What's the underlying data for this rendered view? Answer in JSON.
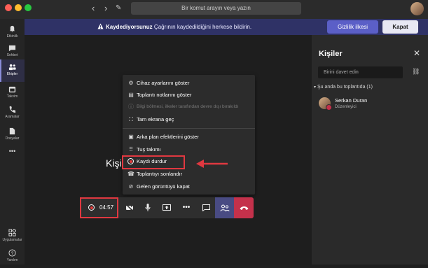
{
  "topbar": {
    "back": "‹",
    "forward": "›",
    "compose": "✎",
    "search_placeholder": "Bir komut arayın veya yazın"
  },
  "sidebar": {
    "items": [
      {
        "label": "Etkinlik",
        "icon": "bell-icon"
      },
      {
        "label": "Sohbet",
        "icon": "chat-icon"
      },
      {
        "label": "Ekipler",
        "icon": "teams-icon"
      },
      {
        "label": "Takvim",
        "icon": "calendar-icon"
      },
      {
        "label": "Aramalar",
        "icon": "phone-icon"
      },
      {
        "label": "Dosyalar",
        "icon": "file-icon"
      },
      {
        "label": "•••",
        "icon": "more-icon"
      },
      {
        "label": "Uygulamalar",
        "icon": "apps-icon"
      },
      {
        "label": "Yardım",
        "icon": "help-icon"
      }
    ]
  },
  "banner": {
    "bold": "Kaydediyorsunuz",
    "text": " Çağrının kaydedildiğini herkese bildirin.",
    "privacy_button": "Gizlilik ilkesi",
    "close_button": "Kapat"
  },
  "main": {
    "stage_label": "Kişil"
  },
  "menu": {
    "items": [
      {
        "label": "Cihaz ayarlarını göster",
        "icon": "gear-icon",
        "disabled": false
      },
      {
        "label": "Toplantı notlarını göster",
        "icon": "notes-icon",
        "disabled": false
      },
      {
        "label": "Bilgi bölmesi, ilkeler tarafından devre dışı bırakıldı",
        "icon": "info-icon",
        "disabled": true
      },
      {
        "label": "Tam ekrana geç",
        "icon": "fullscreen-icon",
        "disabled": false
      },
      {
        "label": "Arka plan efektlerini göster",
        "icon": "background-effects-icon",
        "disabled": false
      },
      {
        "label": "Tuş takımı",
        "icon": "keypad-icon",
        "disabled": false
      },
      {
        "label": "Kaydı durdur",
        "icon": "record-icon",
        "disabled": false
      },
      {
        "label": "Toplantıyı sonlandır",
        "icon": "end-meeting-icon",
        "disabled": false
      },
      {
        "label": "Gelen görüntüyü kapat",
        "icon": "video-off-icon",
        "disabled": false
      }
    ]
  },
  "callbar": {
    "timer": "04:57"
  },
  "panel": {
    "title": "Kişiler",
    "invite_placeholder": "Birini davet edin",
    "section": "Şu anda bu toplantıda (1)",
    "person_name": "Serkan Duran",
    "person_role": "Düzenleyici"
  },
  "colors": {
    "accent": "#5b5fc7",
    "banner": "#2f3266",
    "highlight": "#e03840",
    "hangup": "#c4314b"
  }
}
